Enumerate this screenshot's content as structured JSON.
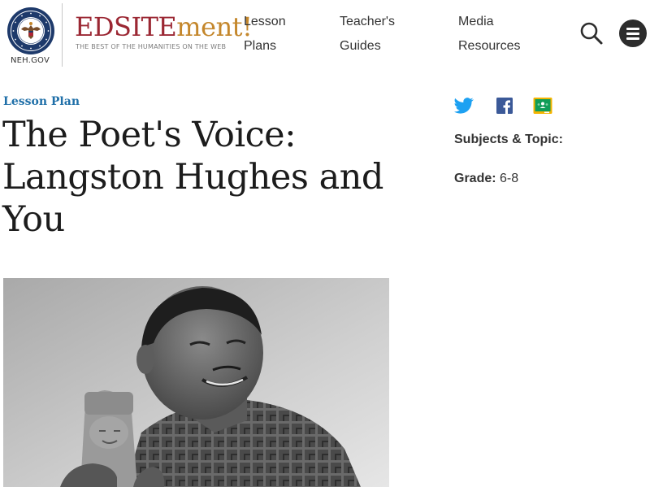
{
  "header": {
    "agency_label": "NEH.GOV",
    "logo": {
      "edsite": "EDSITE",
      "ment": "ment!",
      "tagline": "THE BEST OF THE HUMANITIES ON THE WEB"
    },
    "nav": [
      {
        "line1": "Lesson",
        "line2": "Plans"
      },
      {
        "line1": "Teacher's",
        "line2": "Guides"
      },
      {
        "line1": "Media",
        "line2": "Resources"
      }
    ],
    "icons": {
      "search": "search-icon",
      "menu": "hamburger-menu-icon"
    }
  },
  "main": {
    "eyebrow": "Lesson Plan",
    "title_lines": [
      "The Poet's Voice:",
      "Langston Hughes and",
      "You"
    ]
  },
  "sidebar": {
    "share_icons": [
      "twitter-icon",
      "facebook-icon",
      "google-classroom-icon"
    ],
    "subjects_label": "Subjects & Topic:",
    "grade_label": "Grade:",
    "grade_value": "6-8"
  },
  "colors": {
    "logo_red": "#9b2733",
    "logo_gold": "#c4872c",
    "eyebrow_blue": "#1f6fa8",
    "twitter_blue": "#1da1f2",
    "facebook_blue": "#3b5998",
    "classroom_green": "#0f9d58",
    "classroom_yellow": "#f4b400",
    "menu_button": "#2d2d2d"
  }
}
